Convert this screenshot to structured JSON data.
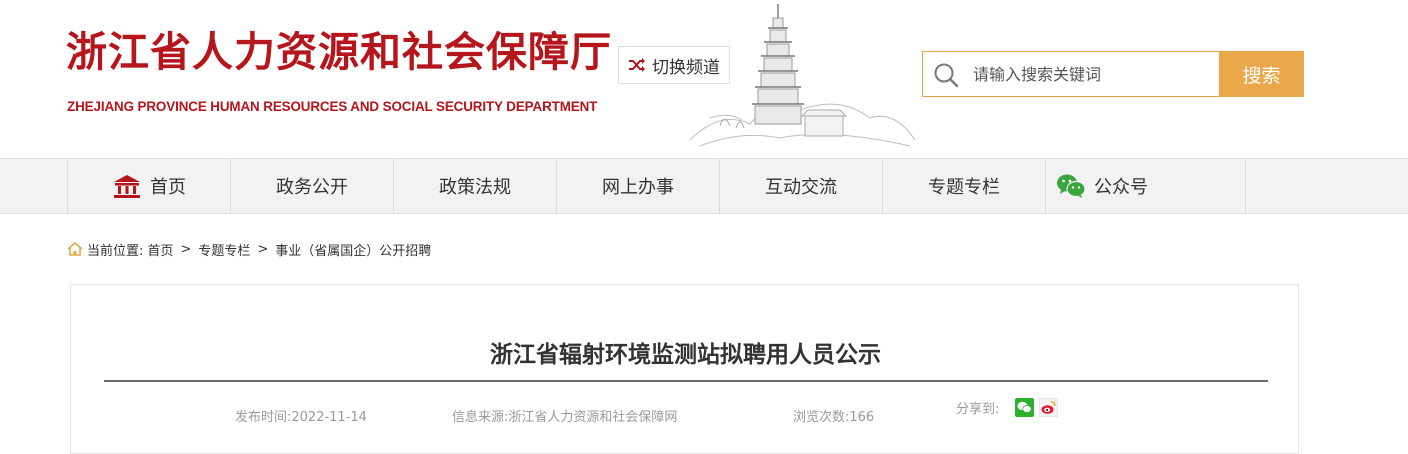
{
  "header": {
    "title": "浙江省人力资源和社会保障厅",
    "subtitle": "ZHEJIANG PROVINCE HUMAN RESOURCES AND SOCIAL SECURITY DEPARTMENT",
    "switch_label": "切换频道",
    "search": {
      "placeholder": "请输入搜索关键词",
      "button_label": "搜索"
    }
  },
  "nav": {
    "items": [
      {
        "label": "首页",
        "icon": "home-building-icon"
      },
      {
        "label": "政务公开"
      },
      {
        "label": "政策法规"
      },
      {
        "label": "网上办事"
      },
      {
        "label": "互动交流"
      },
      {
        "label": "专题专栏"
      },
      {
        "label": "公众号",
        "icon": "wechat-icon"
      }
    ]
  },
  "breadcrumb": {
    "prefix": "当前位置:",
    "items": [
      "首页",
      "专题专栏",
      "事业（省属国企）公开招聘"
    ],
    "separator": ">"
  },
  "article": {
    "title": "浙江省辐射环境监测站拟聘用人员公示",
    "publish_time": "发布时间:2022-11-14",
    "source": "信息来源:浙江省人力资源和社会保障网",
    "views": "浏览次数:166",
    "share_label": "分享到:"
  },
  "colors": {
    "brand_red": "#b5151b",
    "search_accent": "#eaa84a",
    "nav_background": "#f2f2f2",
    "meta_text": "#9a9a9a"
  }
}
